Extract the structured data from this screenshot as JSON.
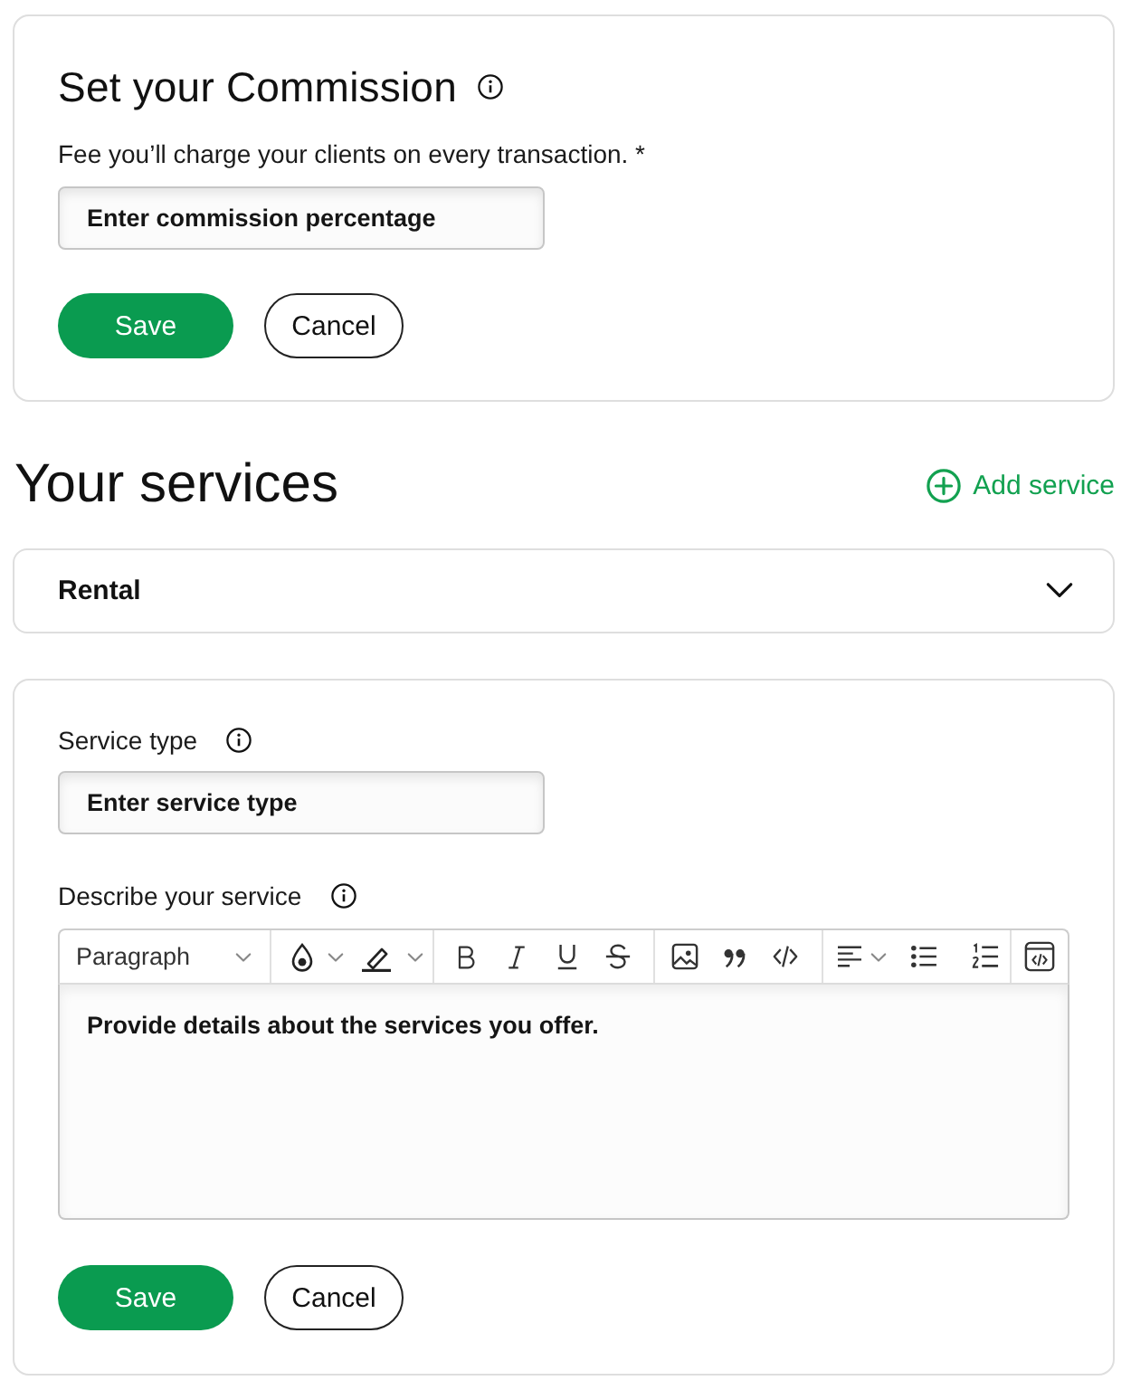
{
  "commission": {
    "title": "Set your Commission",
    "info": true,
    "label": "Fee you’ll charge your clients on every transaction. *",
    "field": {
      "placeholder": "Enter commission percentage"
    },
    "buttons": [
      {
        "label": "Save",
        "kind": "primary"
      },
      {
        "label": "Cancel",
        "kind": "secondary"
      }
    ]
  },
  "services": {
    "title": "Your services",
    "add_button": "Add service",
    "items": [
      {
        "name": "Rental",
        "expanded": false
      }
    ]
  },
  "service_form": {
    "fields": [
      {
        "kind": "text",
        "label": "Service type",
        "info": true,
        "placeholder": "Enter service type"
      },
      {
        "kind": "editor",
        "label": "Describe your service",
        "info": true,
        "block_format": "Paragraph",
        "placeholder": "Provide details about the services you offer."
      }
    ],
    "buttons": [
      {
        "label": "Save",
        "kind": "primary"
      },
      {
        "label": "Cancel",
        "kind": "secondary"
      }
    ]
  }
}
